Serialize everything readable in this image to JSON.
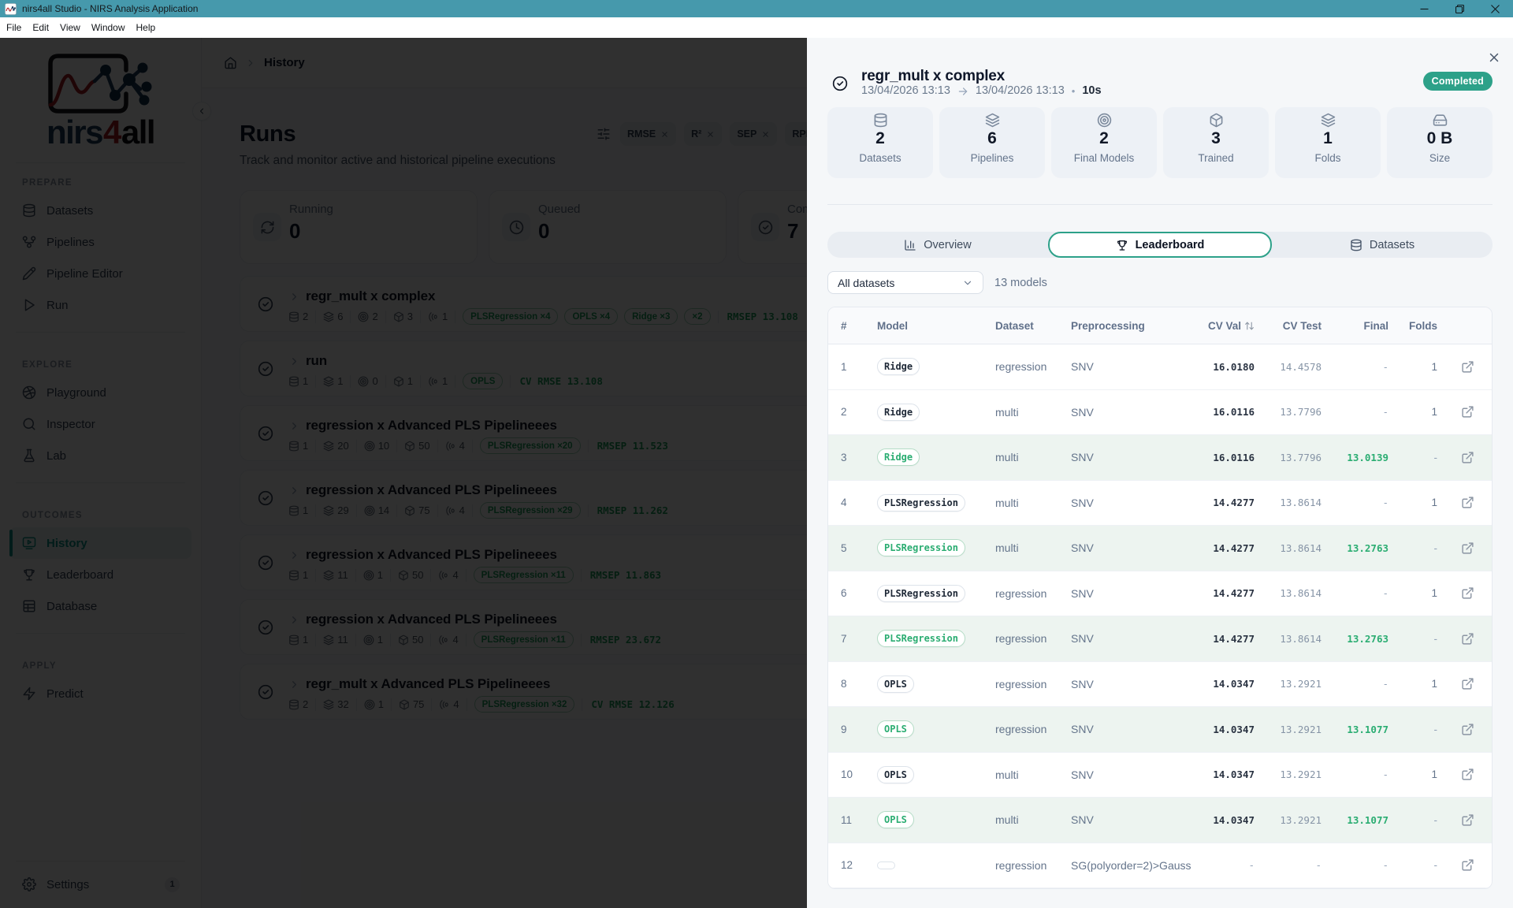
{
  "window": {
    "title": "nirs4all Studio - NIRS Analysis Application"
  },
  "menu": {
    "items": [
      "File",
      "Edit",
      "View",
      "Window",
      "Help"
    ]
  },
  "sidebar": {
    "logo": {
      "nirs": "nirs",
      "four": "4",
      "all": "all"
    },
    "sections": [
      {
        "label": "PREPARE",
        "items": [
          {
            "label": "Datasets",
            "icon": "database"
          },
          {
            "label": "Pipelines",
            "icon": "workflow"
          },
          {
            "label": "Pipeline Editor",
            "icon": "pencil"
          },
          {
            "label": "Run",
            "icon": "play"
          }
        ]
      },
      {
        "label": "EXPLORE",
        "items": [
          {
            "label": "Playground",
            "icon": "playground"
          },
          {
            "label": "Inspector",
            "icon": "search"
          },
          {
            "label": "Lab",
            "icon": "flask"
          }
        ]
      },
      {
        "label": "OUTCOMES",
        "items": [
          {
            "label": "History",
            "icon": "monitor-play",
            "active": true
          },
          {
            "label": "Leaderboard",
            "icon": "trophy"
          },
          {
            "label": "Database",
            "icon": "table"
          }
        ]
      },
      {
        "label": "APPLY",
        "items": [
          {
            "label": "Predict",
            "icon": "zap"
          }
        ]
      }
    ],
    "settings": {
      "label": "Settings",
      "badge": "1"
    }
  },
  "breadcrumb": {
    "page": "History"
  },
  "main": {
    "title": "Runs",
    "subtitle": "Track and monitor active and historical pipeline executions",
    "filter_chips": [
      {
        "label": "RMSE"
      },
      {
        "label": "R²"
      },
      {
        "label": "SEP"
      },
      {
        "label": "RPD"
      }
    ],
    "status_cards": [
      {
        "label": "Running",
        "value": "0",
        "icon": "refresh"
      },
      {
        "label": "Queued",
        "value": "0",
        "icon": "clock"
      },
      {
        "label": "Completed",
        "value": "7",
        "icon": "check-circle"
      }
    ],
    "runs": [
      {
        "title": "regr_mult x complex",
        "datasets": "2",
        "pipelines": "6",
        "models": "2",
        "trained": "3",
        "folds": "1",
        "chips": [
          "PLSRegression ×4",
          "OPLS ×4",
          "Ridge ×3",
          "×2"
        ],
        "metric_label": "RMSEP",
        "metric_value": "13.108"
      },
      {
        "title": "run",
        "datasets": "1",
        "pipelines": "1",
        "models": "0",
        "trained": "1",
        "folds": "1",
        "chips": [
          "OPLS"
        ],
        "metric_label": "CV RMSE",
        "metric_value": "13.108"
      },
      {
        "title": "regression x Advanced PLS Pipelineees",
        "datasets": "1",
        "pipelines": "20",
        "models": "10",
        "trained": "50",
        "folds": "4",
        "chips": [
          "PLSRegression ×20"
        ],
        "metric_label": "RMSEP",
        "metric_value": "11.523"
      },
      {
        "title": "regression x Advanced PLS Pipelineees",
        "datasets": "1",
        "pipelines": "29",
        "models": "14",
        "trained": "75",
        "folds": "4",
        "chips": [
          "PLSRegression ×29"
        ],
        "metric_label": "RMSEP",
        "metric_value": "11.262"
      },
      {
        "title": "regression x Advanced PLS Pipelineees",
        "datasets": "1",
        "pipelines": "11",
        "models": "1",
        "trained": "50",
        "folds": "4",
        "chips": [
          "PLSRegression ×11"
        ],
        "metric_label": "RMSEP",
        "metric_value": "11.863"
      },
      {
        "title": "regression x Advanced PLS Pipelineees",
        "datasets": "1",
        "pipelines": "11",
        "models": "1",
        "trained": "50",
        "folds": "4",
        "chips": [
          "PLSRegression ×11"
        ],
        "metric_label": "RMSEP",
        "metric_value": "23.672"
      },
      {
        "title": "regr_mult x Advanced PLS Pipelineees",
        "datasets": "2",
        "pipelines": "32",
        "models": "1",
        "trained": "75",
        "folds": "4",
        "chips": [
          "PLSRegression ×32"
        ],
        "metric_label": "CV RMSE",
        "metric_value": "12.126"
      }
    ]
  },
  "drawer": {
    "title": "regr_mult x complex",
    "date_start": "13/04/2026 13:13",
    "date_end": "13/04/2026 13:13",
    "duration": "10s",
    "status": "Completed",
    "stats": [
      {
        "value": "2",
        "label": "Datasets",
        "icon": "database"
      },
      {
        "value": "6",
        "label": "Pipelines",
        "icon": "layers"
      },
      {
        "value": "2",
        "label": "Final Models",
        "icon": "target"
      },
      {
        "value": "3",
        "label": "Trained",
        "icon": "box"
      },
      {
        "value": "1",
        "label": "Folds",
        "icon": "layers"
      },
      {
        "value": "0 B",
        "label": "Size",
        "icon": "hard-drive"
      }
    ],
    "tabs": [
      {
        "label": "Overview",
        "icon": "bar-chart"
      },
      {
        "label": "Leaderboard",
        "icon": "trophy",
        "active": true
      },
      {
        "label": "Datasets",
        "icon": "database"
      }
    ],
    "dataset_filter": "All datasets",
    "models_count": "13 models",
    "table": {
      "columns": [
        "#",
        "Model",
        "Dataset",
        "Preprocessing",
        "CV Val",
        "CV Test",
        "Final",
        "Folds"
      ],
      "rows": [
        {
          "rank": "1",
          "model": "Ridge",
          "dataset": "regression",
          "preprocessing": "SNV",
          "cv_val": "16.0180",
          "cv_test": "14.4578",
          "final": "-",
          "folds": "1",
          "highlight": false
        },
        {
          "rank": "2",
          "model": "Ridge",
          "dataset": "multi",
          "preprocessing": "SNV",
          "cv_val": "16.0116",
          "cv_test": "13.7796",
          "final": "-",
          "folds": "1",
          "highlight": false
        },
        {
          "rank": "3",
          "model": "Ridge",
          "dataset": "multi",
          "preprocessing": "SNV",
          "cv_val": "16.0116",
          "cv_test": "13.7796",
          "final": "13.0139",
          "folds": "-",
          "highlight": true
        },
        {
          "rank": "4",
          "model": "PLSRegression",
          "dataset": "multi",
          "preprocessing": "SNV",
          "cv_val": "14.4277",
          "cv_test": "13.8614",
          "final": "-",
          "folds": "1",
          "highlight": false
        },
        {
          "rank": "5",
          "model": "PLSRegression",
          "dataset": "multi",
          "preprocessing": "SNV",
          "cv_val": "14.4277",
          "cv_test": "13.8614",
          "final": "13.2763",
          "folds": "-",
          "highlight": true
        },
        {
          "rank": "6",
          "model": "PLSRegression",
          "dataset": "regression",
          "preprocessing": "SNV",
          "cv_val": "14.4277",
          "cv_test": "13.8614",
          "final": "-",
          "folds": "1",
          "highlight": false
        },
        {
          "rank": "7",
          "model": "PLSRegression",
          "dataset": "regression",
          "preprocessing": "SNV",
          "cv_val": "14.4277",
          "cv_test": "13.8614",
          "final": "13.2763",
          "folds": "-",
          "highlight": true
        },
        {
          "rank": "8",
          "model": "OPLS",
          "dataset": "regression",
          "preprocessing": "SNV",
          "cv_val": "14.0347",
          "cv_test": "13.2921",
          "final": "-",
          "folds": "1",
          "highlight": false
        },
        {
          "rank": "9",
          "model": "OPLS",
          "dataset": "regression",
          "preprocessing": "SNV",
          "cv_val": "14.0347",
          "cv_test": "13.2921",
          "final": "13.1077",
          "folds": "-",
          "highlight": true
        },
        {
          "rank": "10",
          "model": "OPLS",
          "dataset": "multi",
          "preprocessing": "SNV",
          "cv_val": "14.0347",
          "cv_test": "13.2921",
          "final": "-",
          "folds": "1",
          "highlight": false
        },
        {
          "rank": "11",
          "model": "OPLS",
          "dataset": "multi",
          "preprocessing": "SNV",
          "cv_val": "14.0347",
          "cv_test": "13.2921",
          "final": "13.1077",
          "folds": "-",
          "highlight": true
        },
        {
          "rank": "12",
          "model": "",
          "dataset": "regression",
          "preprocessing": "SG(polyorder=2)>Gauss",
          "cv_val": "-",
          "cv_test": "-",
          "final": "-",
          "folds": "-",
          "highlight": false
        }
      ]
    }
  },
  "colors": {
    "titlebar": "#4699ac",
    "accent_teal": "#2da189",
    "green": "#2bad72",
    "sidebar_active": "#0d9488"
  }
}
